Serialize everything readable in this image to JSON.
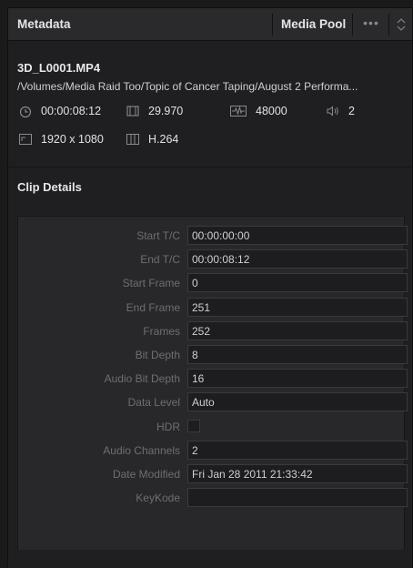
{
  "header": {
    "title": "Metadata",
    "media_pool_label": "Media Pool",
    "more_icon": "ellipsis-icon",
    "sort_icon": "up-down-chevron-icon"
  },
  "file": {
    "name": "3D_L0001.MP4",
    "path": "/Volumes/Media Raid Too/Topic of Cancer Taping/August 2 Performa...",
    "duration": "00:00:08:12",
    "frame_rate": "29.970",
    "audio_rate": "48000",
    "audio_channels": "2",
    "resolution": "1920 x 1080",
    "codec": "H.264"
  },
  "clip_details": {
    "title": "Clip Details",
    "rows": [
      {
        "label": "Start T/C",
        "value": "00:00:00:00"
      },
      {
        "label": "End T/C",
        "value": "00:00:08:12"
      },
      {
        "label": "Start Frame",
        "value": "0"
      },
      {
        "label": "End Frame",
        "value": "251"
      },
      {
        "label": "Frames",
        "value": "252"
      },
      {
        "label": "Bit Depth",
        "value": "8"
      },
      {
        "label": "Audio Bit Depth",
        "value": "16"
      },
      {
        "label": "Data Level",
        "value": "Auto"
      },
      {
        "label": "HDR",
        "value": ""
      },
      {
        "label": "Audio Channels",
        "value": "2"
      },
      {
        "label": "Date Modified",
        "value": "Fri Jan 28 2011 21:33:42"
      },
      {
        "label": "KeyKode",
        "value": ""
      }
    ]
  },
  "colors": {
    "panel_bg": "#1f1f21",
    "header_bg": "#2a2a2d",
    "field_bg": "#1d1d1f",
    "label_text": "#6e6e6e",
    "value_text": "#cfcfcf"
  }
}
